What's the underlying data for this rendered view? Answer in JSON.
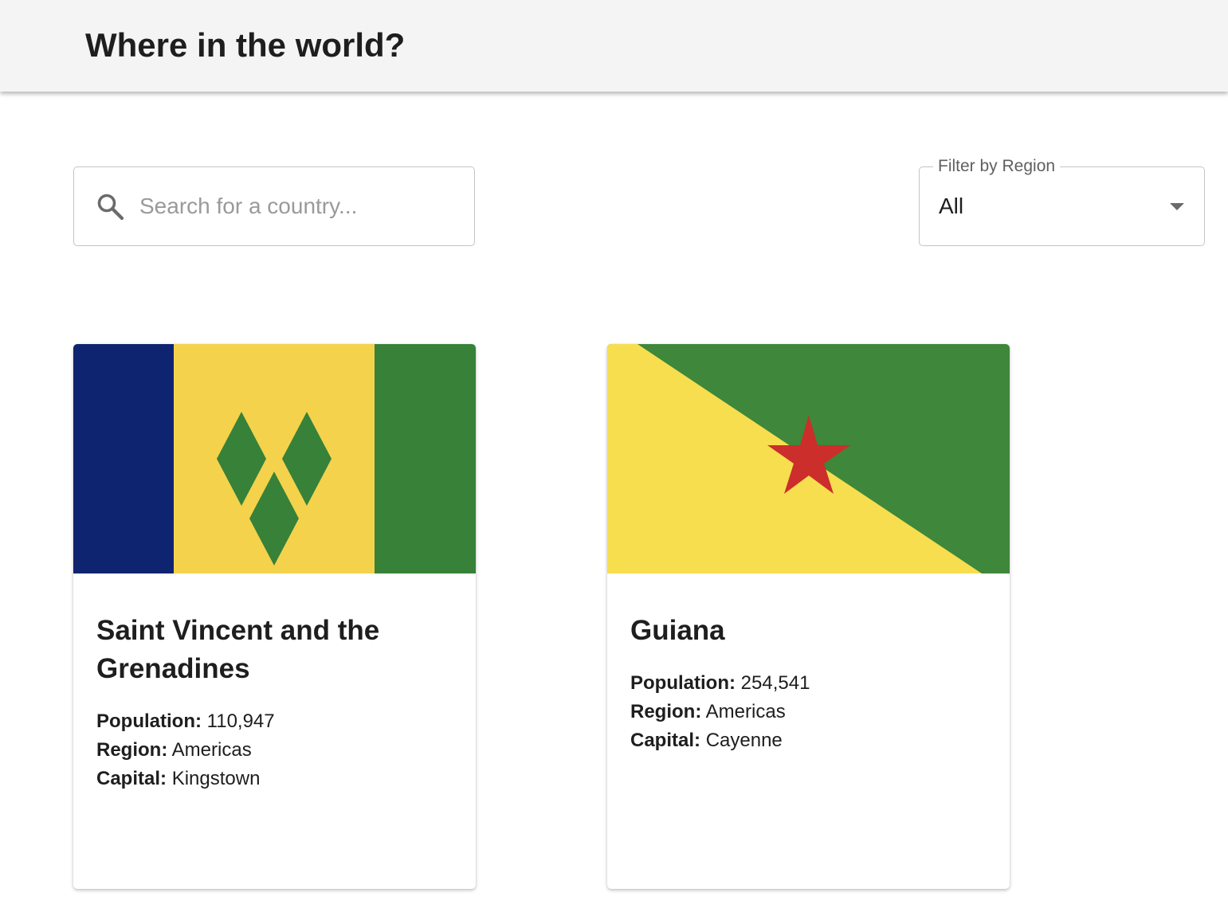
{
  "header": {
    "title": "Where in the world?"
  },
  "search": {
    "placeholder": "Search for a country...",
    "icon": "search-icon"
  },
  "filter": {
    "label": "Filter by Region",
    "selected": "All",
    "icon": "chevron-down-icon"
  },
  "stat_labels": {
    "population": "Population:",
    "region": "Region:",
    "capital": "Capital:"
  },
  "countries": [
    {
      "name": "Saint Vincent and the Grenadines",
      "population": "110,947",
      "region": "Americas",
      "capital": "Kingstown",
      "flag_colors": {
        "blue": "#0f2470",
        "yellow": "#f4d24c",
        "green": "#378139"
      }
    },
    {
      "name": "Guiana",
      "population": "254,541",
      "region": "Americas",
      "capital": "Cayenne",
      "flag_colors": {
        "yellow": "#f6de4f",
        "green": "#3e873b",
        "star": "#cc2e2b"
      }
    }
  ]
}
